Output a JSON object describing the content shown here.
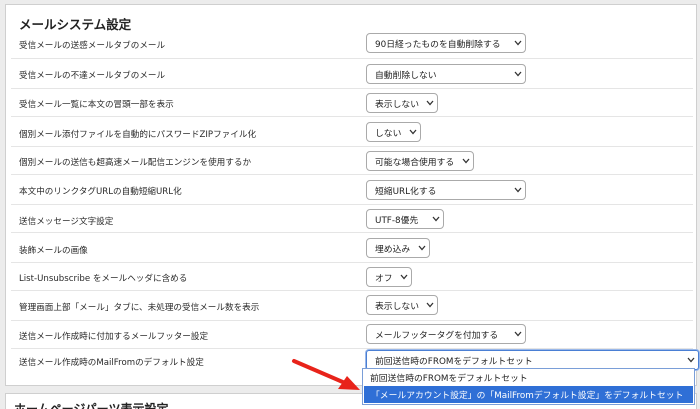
{
  "section": {
    "title": "メールシステム設定"
  },
  "rows": [
    {
      "label": "受信メールの送感メールタブのメール",
      "value": "90日経ったものを自動削除する"
    },
    {
      "label": "受信メールの不達メールタブのメール",
      "value": "自動削除しない"
    },
    {
      "label": "受信メール一覧に本文の冒頭一部を表示",
      "value": "表示しない"
    },
    {
      "label": "個別メール添付ファイルを自動的にパスワードZIPファイル化",
      "value": "しない"
    },
    {
      "label": "個別メールの送信も超高速メール配信エンジンを使用するか",
      "value": "可能な場合使用する"
    },
    {
      "label": "本文中のリンクタグURLの自動短縮URL化",
      "value": "短縮URL化する"
    },
    {
      "label": "送信メッセージ文字設定",
      "value": "UTF-8優先"
    },
    {
      "label": "装飾メールの画像",
      "value": "埋め込み"
    },
    {
      "label": "List-Unsubscribe をメールヘッダに含める",
      "value": "オフ"
    },
    {
      "label": "管理画面上部「メール」タブに、未処理の受信メール数を表示",
      "value": "表示しない"
    },
    {
      "label": "送信メール作成時に付加するメールフッター設定",
      "value": "メールフッタータグを付加する"
    },
    {
      "label": "送信メール作成時のMailFromのデフォルト設定",
      "value": "前回送信時のFROMをデフォルトセット"
    }
  ],
  "dropdown": {
    "options": [
      "前回送信時のFROMをデフォルトセット",
      "「メールアカウント設定」の「MailFromデフォルト設定」をデフォルトセット"
    ],
    "highlighted_index": 1
  },
  "next_section": {
    "title": "ホームページパーツ表示設定"
  },
  "colors": {
    "highlight": "#2f6fd6",
    "arrow": "#e8231a",
    "focus_border": "#4a7fd4"
  }
}
